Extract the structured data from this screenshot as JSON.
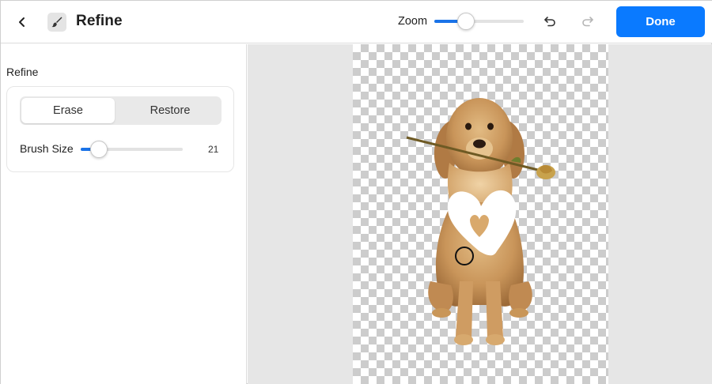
{
  "header": {
    "title": "Refine",
    "back_icon": "chevron-left-icon",
    "tool_icon": "brush-icon",
    "zoom_label": "Zoom",
    "zoom_level": 0.35,
    "undo_icon": "undo-icon",
    "redo_icon": "redo-icon",
    "done_label": "Done",
    "accent_color": "#0a7aff"
  },
  "sidebar": {
    "section_label": "Refine",
    "modes": [
      {
        "label": "Erase",
        "selected": true
      },
      {
        "label": "Restore",
        "selected": false
      }
    ],
    "brush_size_label": "Brush Size",
    "brush_size_value": "21",
    "brush_size_level": 0.18
  },
  "canvas": {
    "background": "transparency-checkerboard",
    "subject": "dog holding a rose in its mouth",
    "cursor": "brush-circle"
  }
}
